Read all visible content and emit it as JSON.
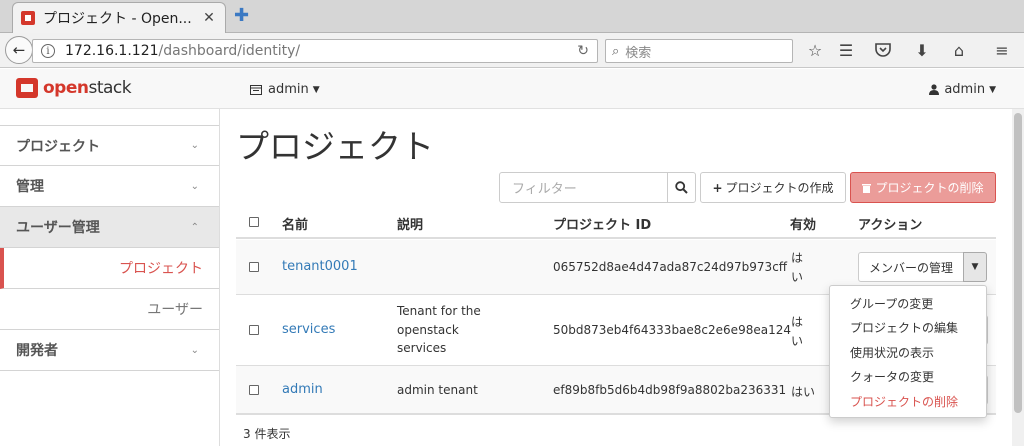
{
  "browser": {
    "tab_title": "プロジェクト - Open...",
    "tab_close": "✕",
    "new_tab": "✚",
    "url_host": "172.16.1.121",
    "url_path": "/dashboard/identity/",
    "search_placeholder": "検索"
  },
  "header": {
    "logo_open": "open",
    "logo_stack": "stack",
    "project": "admin",
    "user": "admin"
  },
  "sidebar": {
    "items": [
      {
        "label": "プロジェクト"
      },
      {
        "label": "管理"
      },
      {
        "label": "ユーザー管理"
      },
      {
        "label": "プロジェクト"
      },
      {
        "label": "ユーザー"
      },
      {
        "label": "開発者"
      }
    ]
  },
  "main": {
    "title": "プロジェクト",
    "filter_placeholder": "フィルター",
    "create_label": "プロジェクトの作成",
    "delete_label": "プロジェクトの削除",
    "columns": [
      "名前",
      "説明",
      "プロジェクト ID",
      "有効",
      "アクション"
    ],
    "rows": [
      {
        "name": "tenant0001",
        "desc_1": "",
        "desc_2": "",
        "desc_3": "",
        "id": "065752d8ae4d47ada87c24d97b973cff",
        "enabled_1": "は",
        "enabled_2": "い",
        "action": "メンバーの管理"
      },
      {
        "name": "services",
        "desc_1": "Tenant for the",
        "desc_2": "openstack",
        "desc_3": "services",
        "id": "50bd873eb4f64333bae8c2e6e98ea124",
        "enabled_1": "は",
        "enabled_2": "い"
      },
      {
        "name": "admin",
        "desc_1": "admin tenant",
        "id": "ef89b8fb5d6b4db98f9a8802ba236331",
        "enabled_1": "はい"
      }
    ],
    "dropdown": [
      "グループの変更",
      "プロジェクトの編集",
      "使用状況の表示",
      "クォータの変更",
      "プロジェクトの削除"
    ],
    "count": "3 件表示"
  },
  "colors": {
    "brand_red": "#d4372b",
    "danger": "#d9534f",
    "link": "#337ab7"
  }
}
